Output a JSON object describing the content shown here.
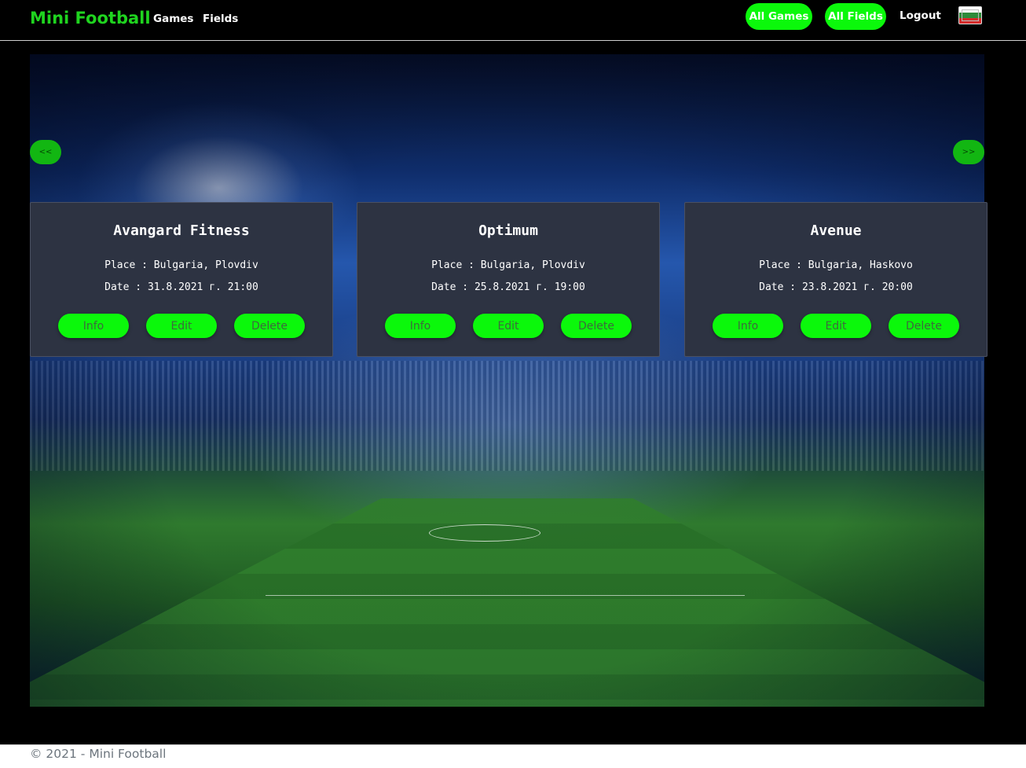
{
  "nav": {
    "brand": "Mini Football",
    "links": [
      "Games",
      "Fields"
    ],
    "all_games": "All Games",
    "all_fields": "All Fields",
    "logout": "Logout",
    "flag_icon": "bulgarian-flag-icon"
  },
  "carousel": {
    "prev": "<<",
    "next": ">>"
  },
  "cards": [
    {
      "title": "Avangard Fitness",
      "place": "Place : Bulgaria, Plovdiv",
      "date": "Date : 31.8.2021 г. 21:00",
      "info": "Info",
      "edit": "Edit",
      "delete": "Delete"
    },
    {
      "title": "Optimum",
      "place": "Place : Bulgaria, Plovdiv",
      "date": "Date : 25.8.2021 г. 19:00",
      "info": "Info",
      "edit": "Edit",
      "delete": "Delete"
    },
    {
      "title": "Avenue",
      "place": "Place : Bulgaria, Haskovo",
      "date": "Date : 23.8.2021 г. 20:00",
      "info": "Info",
      "edit": "Edit",
      "delete": "Delete"
    }
  ],
  "footer": {
    "text": "© 2021 - Mini Football"
  },
  "colors": {
    "accent": "#0bf80b",
    "brand": "#1fd41f",
    "card_bg": "#2d3342"
  }
}
